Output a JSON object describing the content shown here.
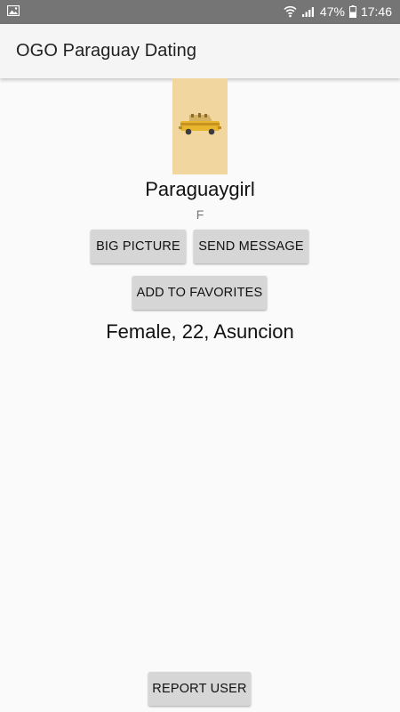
{
  "status_bar": {
    "battery": "47%",
    "time": "17:46",
    "icons": [
      "image-icon",
      "wifi-icon",
      "signal-icon",
      "battery-icon"
    ]
  },
  "app_bar": {
    "title": "OGO Paraguay Dating"
  },
  "profile": {
    "username": "Paraguaygirl",
    "gender_letter": "F",
    "info": "Female, 22, Asuncion",
    "photo_icon": "taxi-car-icon"
  },
  "actions": {
    "big_picture": "BIG PICTURE",
    "send_message": "SEND MESSAGE",
    "add_to_favorites": "ADD TO FAVORITES",
    "report_user": "REPORT USER"
  },
  "colors": {
    "status_bar": "#757575",
    "app_bar": "#f5f5f5",
    "background": "#fafafa",
    "button": "#d6d6d6",
    "photo_bg": "#f1d69f"
  }
}
